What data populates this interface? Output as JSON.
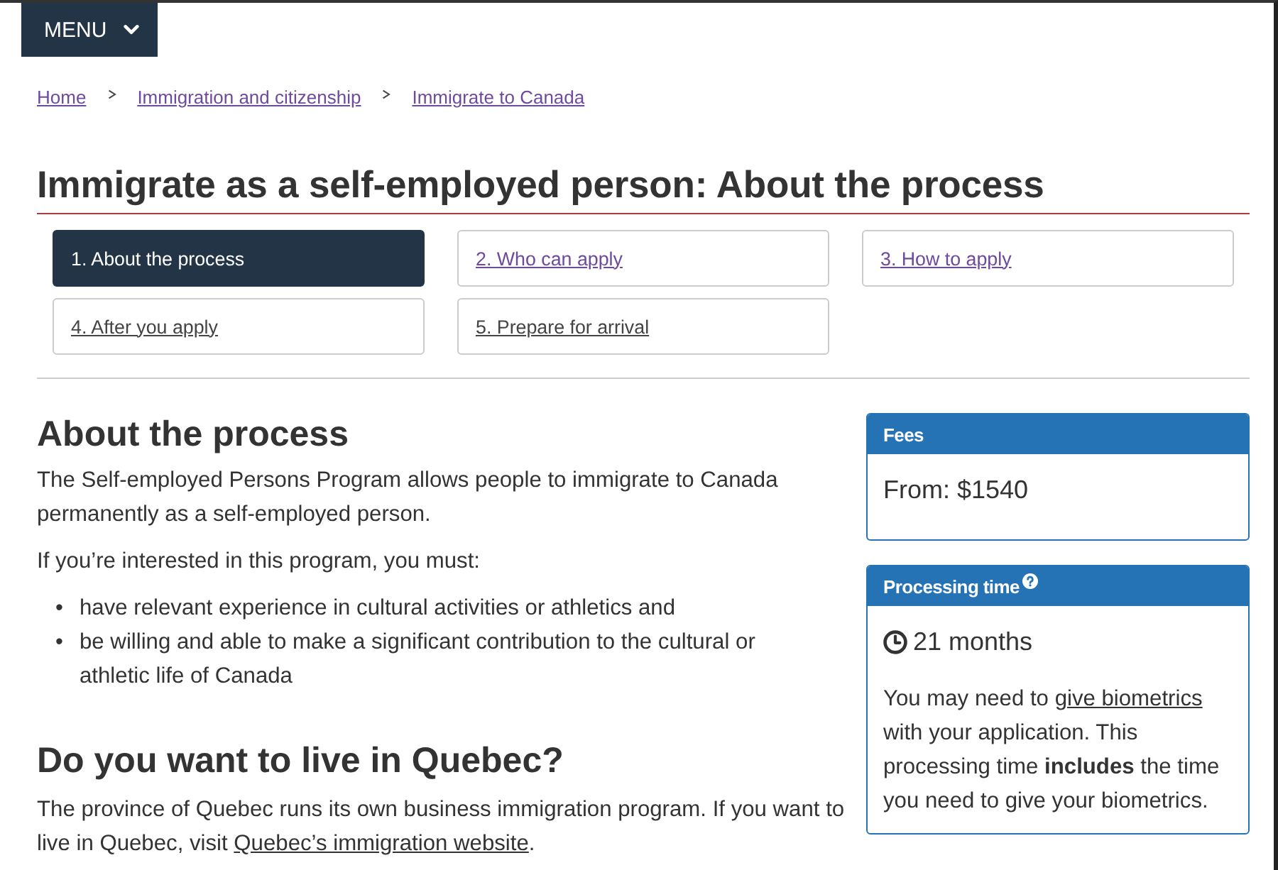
{
  "menu_button": {
    "label": "MENU"
  },
  "breadcrumb": [
    {
      "label": "Home"
    },
    {
      "label": "Immigration and citizenship"
    },
    {
      "label": "Immigrate to Canada"
    }
  ],
  "page_title": "Immigrate as a self-employed person: About the process",
  "steps": [
    {
      "label": "1. About the process",
      "selected": true,
      "visited": false
    },
    {
      "label": "2. Who can apply",
      "selected": false,
      "visited": true
    },
    {
      "label": "3. How to apply",
      "selected": false,
      "visited": true
    },
    {
      "label": "4. After you apply",
      "selected": false,
      "visited": false
    },
    {
      "label": "5. Prepare for arrival",
      "selected": false,
      "visited": false
    }
  ],
  "main": {
    "sections": [
      {
        "heading": "About the process",
        "blocks": [
          {
            "kind": "paragraph",
            "parts": [
              {
                "kind": "text",
                "text": "The Self-employed Persons Program allows people to immigrate to Canada permanently as a self-employed person."
              }
            ]
          },
          {
            "kind": "paragraph",
            "parts": [
              {
                "kind": "text",
                "text": "If you’re interested in this program, you must:"
              }
            ]
          },
          {
            "kind": "list",
            "items": [
              {
                "marker": "•",
                "text": "have relevant experience in cultural activities or athletics and"
              },
              {
                "marker": "•",
                "text": "be willing and able to make a significant contribution to the cultural or athletic life of Canada"
              }
            ]
          }
        ]
      },
      {
        "heading": "Do you want to live in Quebec?",
        "blocks": [
          {
            "kind": "paragraph",
            "parts": [
              {
                "kind": "text",
                "text": "The province of Quebec runs its own business immigration program. If you want to live in Quebec, visit "
              },
              {
                "kind": "link",
                "text": "Quebec’s immigration website"
              },
              {
                "kind": "text",
                "text": "."
              }
            ]
          }
        ]
      }
    ]
  },
  "sidebar": {
    "panels": [
      {
        "kind": "fees",
        "title": "Fees",
        "help": false,
        "value": "From: $1540"
      },
      {
        "kind": "time",
        "title": "Processing time",
        "help": true,
        "value": "21 months",
        "note": [
          {
            "kind": "text",
            "text": "You may need to "
          },
          {
            "kind": "link",
            "text": "give biometrics"
          },
          {
            "kind": "text",
            "text": " with your application. This processing time **includes** the time you need to give your biometrics."
          }
        ]
      }
    ]
  }
}
